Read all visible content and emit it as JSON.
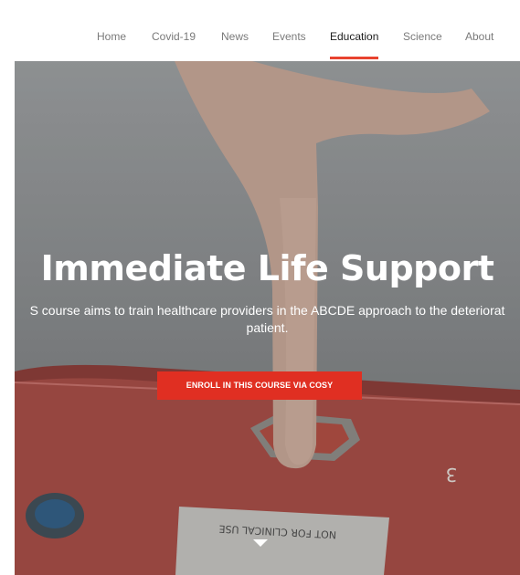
{
  "nav": {
    "items": [
      {
        "label": "Home",
        "active": false
      },
      {
        "label": "Covid-19",
        "active": false
      },
      {
        "label": "News",
        "active": false
      },
      {
        "label": "Events",
        "active": false
      },
      {
        "label": "Education",
        "active": true
      },
      {
        "label": "Science",
        "active": false
      },
      {
        "label": "About",
        "active": false
      }
    ]
  },
  "hero": {
    "title": "Immediate Life Support",
    "description_line1": "S course aims to train healthcare providers in the ABCDE approach to the deteriorat",
    "description_line2": "patient.",
    "button_label": "ENROLL IN THIS COURSE VIA COSY",
    "device_label": "NOT FOR CLINICAL USE",
    "device_number": "3"
  },
  "colors": {
    "accent": "#e02f22",
    "nav_underline": "#e8432f",
    "nav_text": "#7a7a7a",
    "nav_text_active": "#1d1d1d"
  },
  "icons": {
    "scroll_down": "triangle-down-icon"
  }
}
